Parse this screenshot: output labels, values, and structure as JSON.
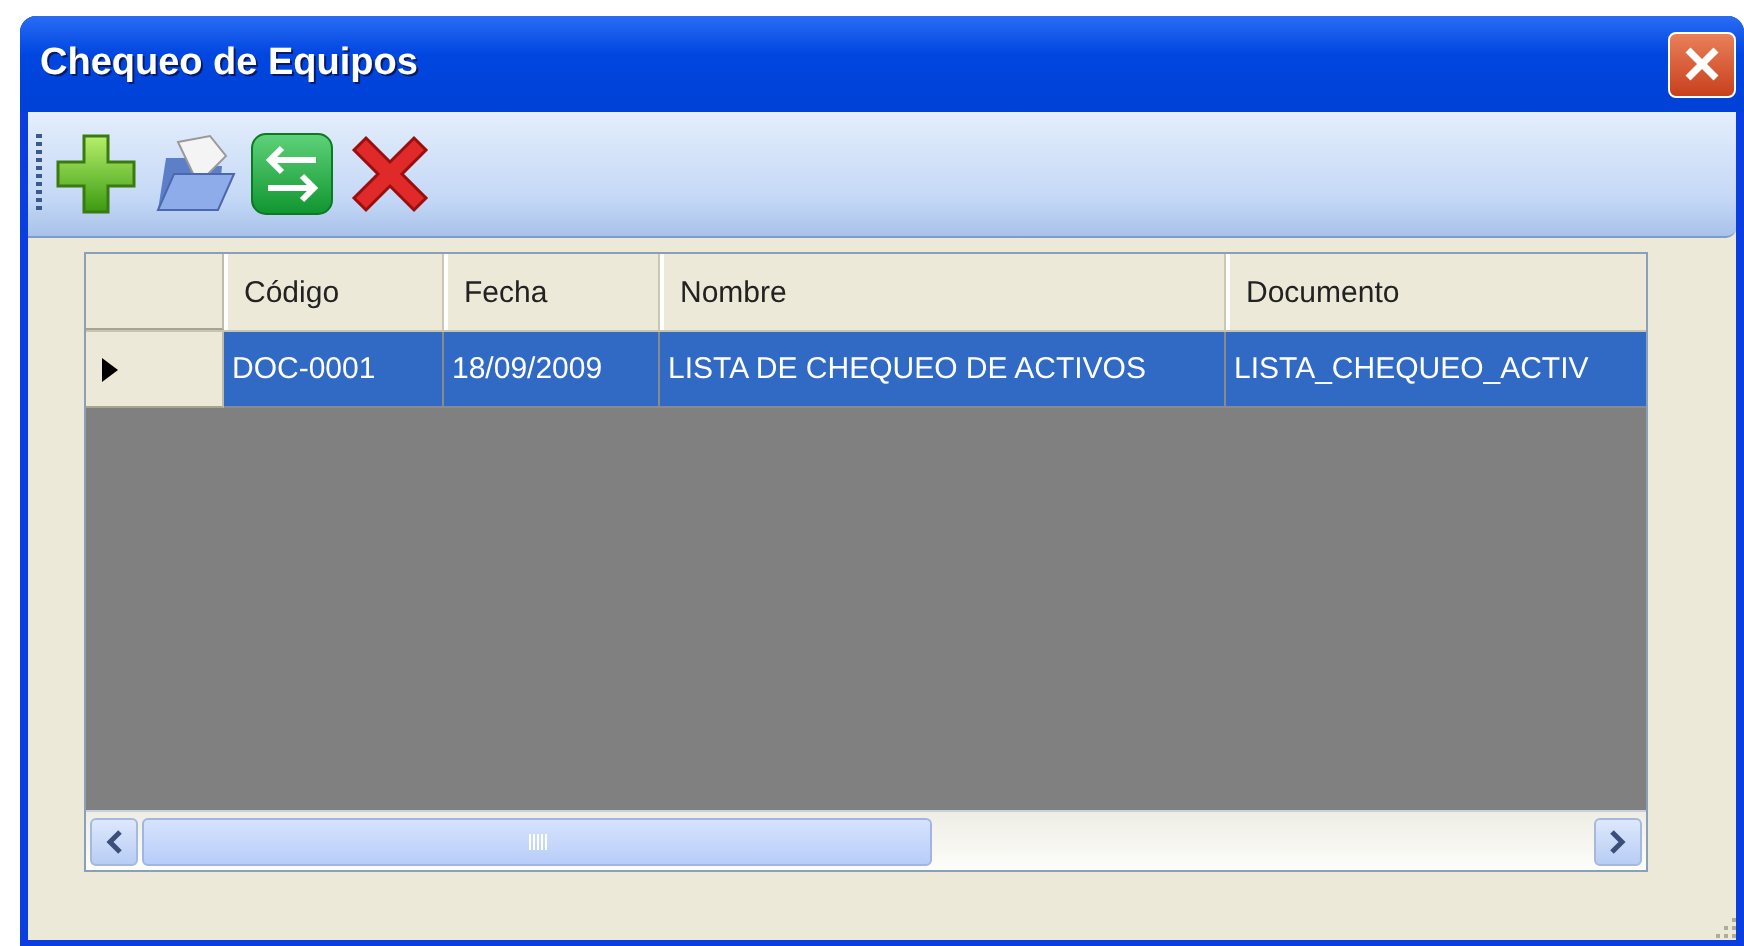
{
  "window": {
    "title": "Chequeo de Equipos"
  },
  "toolbar": {
    "buttons": [
      {
        "kind": "add"
      },
      {
        "kind": "open"
      },
      {
        "kind": "swap"
      },
      {
        "kind": "delete"
      }
    ]
  },
  "table": {
    "columns": [
      "Código",
      "Fecha",
      "Nombre",
      "Documento"
    ],
    "rows": [
      {
        "selected": true,
        "cells": [
          "DOC-0001",
          "18/09/2009",
          "LISTA DE CHEQUEO DE ACTIVOS",
          "LISTA_CHEQUEO_ACTIV"
        ]
      }
    ]
  }
}
